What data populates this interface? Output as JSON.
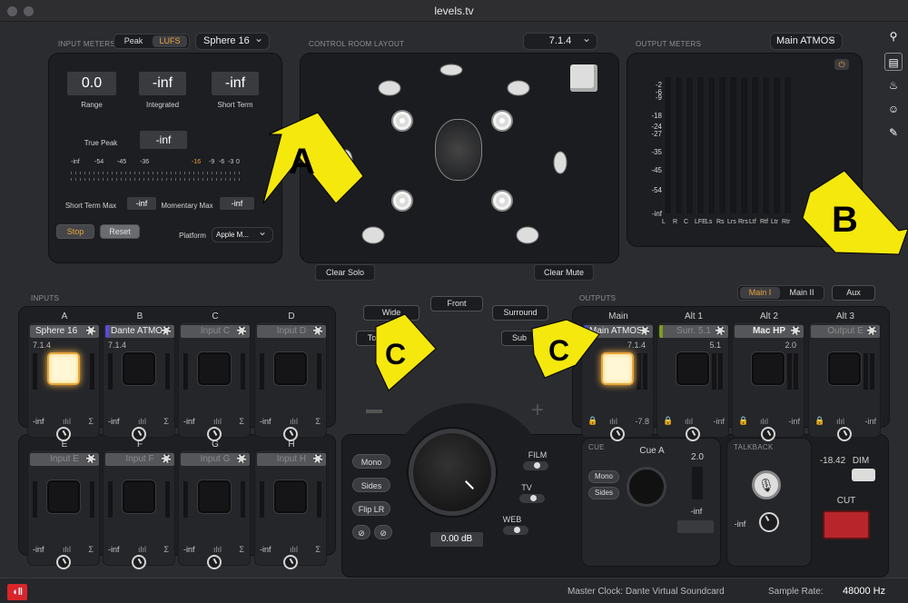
{
  "window": {
    "title": "levels.tv"
  },
  "input_meters": {
    "section_label": "INPUT METERS",
    "peak_btn": "Peak",
    "lufs_btn": "LUFS",
    "source": "Sphere 16",
    "range_value": "0.0",
    "range_label": "Range",
    "integrated_value": "-inf",
    "integrated_label": "Integrated",
    "shortterm_value": "-inf",
    "shortterm_label": "Short Term",
    "truepeak_label": "True Peak",
    "truepeak_value": "-inf",
    "ticks": [
      "-inf",
      "-54",
      "-45",
      "-36",
      "-16",
      "-9",
      "-6",
      "-3",
      "0"
    ],
    "stmax_label": "Short Term Max",
    "stmax_value": "-inf",
    "mommax_label": "Momentary Max",
    "mommax_value": "-inf",
    "stop_btn": "Stop",
    "reset_btn": "Reset",
    "platform_label": "Platform",
    "platform_value": "Apple M..."
  },
  "control_room": {
    "section_label": "CONTROL ROOM LAYOUT",
    "layout": "7.1.4",
    "clear_solo": "Clear Solo",
    "clear_mute": "Clear Mute"
  },
  "output_meters": {
    "section_label": "OUTPUT METERS",
    "target": "Main ATMOS",
    "scale": [
      "-2",
      "-6",
      "-9",
      "-18",
      "-24",
      "-27",
      "-35",
      "-45",
      "-54",
      "-inf"
    ],
    "channels": [
      "L",
      "R",
      "C",
      "LFE",
      "Ls",
      "Rs",
      "Lrs",
      "Rrs",
      "Ltf",
      "Rtf",
      "Ltr",
      "Rtr"
    ]
  },
  "inputs": {
    "section_label": "INPUTS",
    "channels": [
      {
        "letter": "A",
        "name": "Sphere 16",
        "format": "7.1.4",
        "level": "-inf"
      },
      {
        "letter": "B",
        "name": "Dante ATMOS",
        "format": "7.1.4",
        "level": "-inf"
      },
      {
        "letter": "C",
        "name": "Input C",
        "format": "",
        "level": "-inf"
      },
      {
        "letter": "D",
        "name": "Input D",
        "format": "",
        "level": "-inf"
      },
      {
        "letter": "E",
        "name": "Input E",
        "format": "",
        "level": "-inf"
      },
      {
        "letter": "F",
        "name": "Input F",
        "format": "",
        "level": "-inf"
      },
      {
        "letter": "G",
        "name": "Input G",
        "format": "",
        "level": "-inf"
      },
      {
        "letter": "H",
        "name": "Input H",
        "format": "",
        "level": "-inf"
      }
    ]
  },
  "outputs": {
    "section_label": "OUTPUTS",
    "main1": "Main I",
    "main2": "Main II",
    "aux": "Aux",
    "channels": [
      {
        "letter": "Main",
        "name": "Main ATMOS",
        "format": "7.1.4",
        "level": "-7.8"
      },
      {
        "letter": "Alt 1",
        "name": "Surr. 5.1",
        "format": "5.1",
        "level": "-inf"
      },
      {
        "letter": "Alt 2",
        "name": "Mac HP",
        "format": "2.0",
        "level": "-inf"
      },
      {
        "letter": "Alt 3",
        "name": "Output E",
        "format": "",
        "level": "-inf"
      }
    ]
  },
  "speaker_groups": {
    "wide": "Wide",
    "front": "Front",
    "surround": "Surround",
    "top": "Top",
    "sub": "Sub"
  },
  "monitor": {
    "mono": "Mono",
    "sides": "Sides",
    "flip": "Flip LR",
    "volume": "0.00 dB",
    "film": "FILM",
    "tv": "TV",
    "web": "WEB"
  },
  "cue": {
    "section_label": "CUE",
    "name": "Cue A",
    "mono": "Mono",
    "sides": "Sides",
    "format": "2.0",
    "level": "-inf"
  },
  "talkback": {
    "section_label": "TALKBACK",
    "level": "-inf",
    "dim_value": "-18.42",
    "dim_label": "DIM",
    "cut_label": "CUT"
  },
  "annotations": {
    "a": "A",
    "b": "B",
    "c1": "C",
    "c2": "C"
  },
  "status": {
    "clock": "Master Clock: Dante Virtual Soundcard",
    "rate_label": "Sample Rate:",
    "rate_value": "48000 Hz"
  },
  "colors": {
    "accent": "#e8a33a",
    "cut": "#b8262b",
    "annotation": "#f5e80c",
    "dante": "#5a4be0",
    "main_atmos": "#3d4fe0",
    "surr": "#7c9b1c"
  }
}
